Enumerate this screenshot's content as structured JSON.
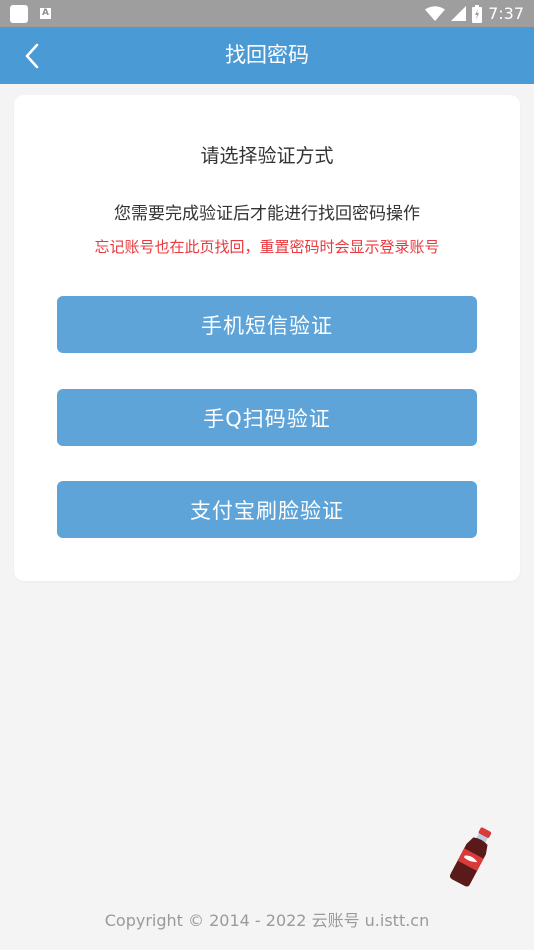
{
  "status_bar": {
    "time": "7:37",
    "a_icon_label": "A",
    "icons": [
      "wifi-icon",
      "signal-icon",
      "battery-icon"
    ]
  },
  "header": {
    "title": "找回密码",
    "back_icon": "chevron-left-icon"
  },
  "card": {
    "title": "请选择验证方式",
    "description": "您需要完成验证后才能进行找回密码操作",
    "note": "忘记账号也在此页找回，重置密码时会显示登录账号"
  },
  "buttons": {
    "sms": "手机短信验证",
    "qq_scan": "手Q扫码验证",
    "alipay_face": "支付宝刷脸验证"
  },
  "footer": {
    "copyright": "Copyright © 2014 - 2022 云账号 u.istt.cn"
  },
  "colors": {
    "status_bar": "#9e9e9e",
    "header": "#4a9ad6",
    "button": "#5ea4d8",
    "note": "#e8393e",
    "background": "#f4f4f4"
  }
}
